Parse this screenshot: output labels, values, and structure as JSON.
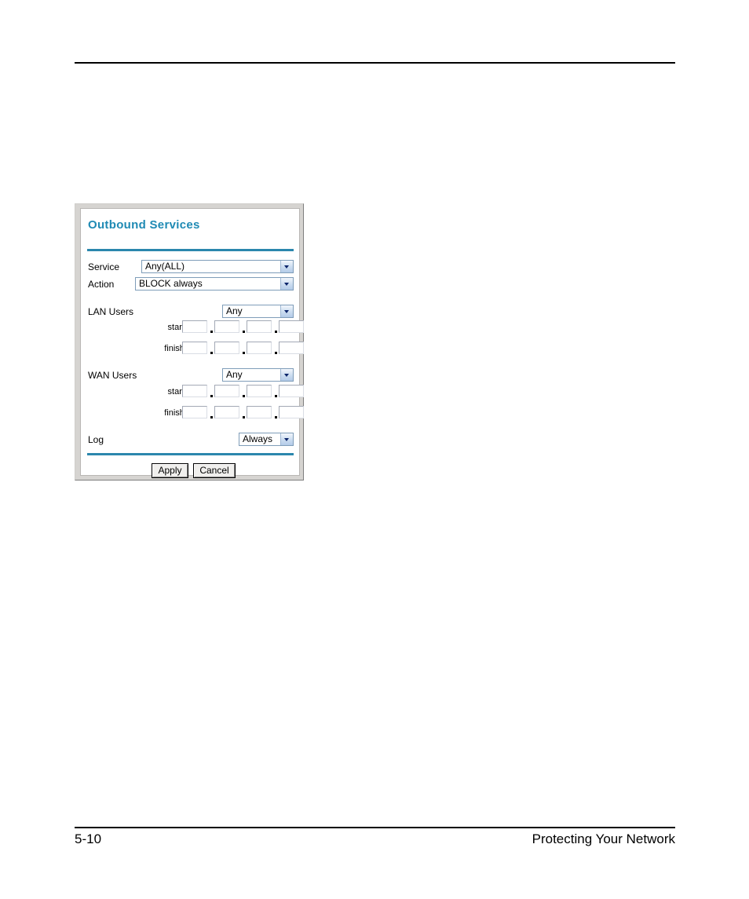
{
  "document": {
    "footer": {
      "page_number": "5-10",
      "section_title": "Protecting Your Network"
    }
  },
  "panel": {
    "title": "Outbound Services",
    "fields": {
      "service": {
        "label": "Service",
        "value": "Any(ALL)"
      },
      "action": {
        "label": "Action",
        "value": "BLOCK always"
      },
      "lan_users": {
        "label": "LAN Users",
        "value": "Any",
        "start_label": "start:",
        "finish_label": "finish:",
        "start_octets": [
          "",
          "",
          "",
          ""
        ],
        "finish_octets": [
          "",
          "",
          "",
          ""
        ]
      },
      "wan_users": {
        "label": "WAN Users",
        "value": "Any",
        "start_label": "start:",
        "finish_label": "finish:",
        "start_octets": [
          "",
          "",
          "",
          ""
        ],
        "finish_octets": [
          "",
          "",
          "",
          ""
        ]
      },
      "log": {
        "label": "Log",
        "value": "Always"
      }
    },
    "buttons": {
      "apply": "Apply",
      "cancel": "Cancel"
    },
    "colors": {
      "title": "#1f8ab4",
      "divider": "#2b87ad",
      "select_border": "#7f9db9"
    }
  }
}
